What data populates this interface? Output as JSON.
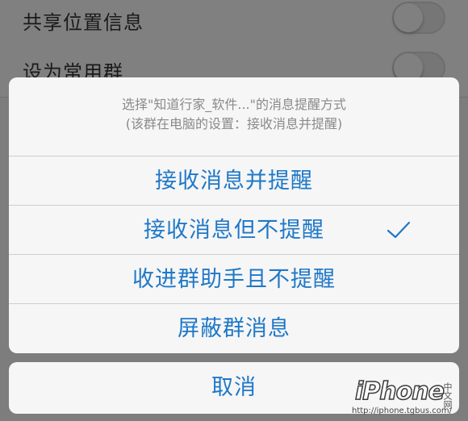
{
  "background": {
    "rows": [
      {
        "label": "共享位置信息"
      },
      {
        "label": "设为常用群"
      }
    ]
  },
  "sheet": {
    "title": "选择\"知道行家_软件...\"的消息提醒方式",
    "subtitle": "(该群在电脑的设置：接收消息并提醒)",
    "options": [
      {
        "label": "接收消息并提醒",
        "selected": false
      },
      {
        "label": "接收消息但不提醒",
        "selected": true
      },
      {
        "label": "收进群助手且不提醒",
        "selected": false
      },
      {
        "label": "屏蔽群消息",
        "selected": false
      }
    ]
  },
  "cancel": {
    "label": "取消"
  },
  "watermark": {
    "logo": "iPhone",
    "cn": "中文网",
    "url": "http://iphone.tgbus.com/"
  },
  "colors": {
    "accent": "#1f78c8",
    "sheet_bg": "#f6f6f6",
    "dim_overlay": "#7d7d7d",
    "secondary_text": "#8a8a8a"
  },
  "icons": {
    "selected_marker": "checkmark-icon"
  }
}
